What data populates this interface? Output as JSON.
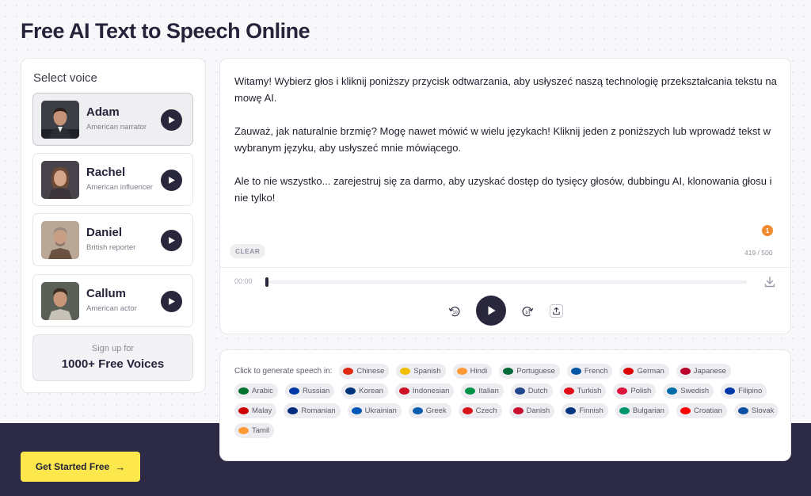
{
  "page": {
    "title": "Free AI Text to Speech Online"
  },
  "voice_panel": {
    "label": "Select voice",
    "voices": [
      {
        "name": "Adam",
        "description": "American narrator",
        "selected": true
      },
      {
        "name": "Rachel",
        "description": "American influencer",
        "selected": false
      },
      {
        "name": "Daniel",
        "description": "British reporter",
        "selected": false
      },
      {
        "name": "Callum",
        "description": "American actor",
        "selected": false
      }
    ],
    "signup": {
      "small": "Sign up for",
      "big": "1000+ Free Voices"
    }
  },
  "editor": {
    "paragraphs": [
      "Witamy! Wybierz głos i kliknij poniższy przycisk odtwarzania, aby usłyszeć naszą technologię przekształcania tekstu na mowę AI.",
      "Zauważ, jak naturalnie brzmię? Mogę nawet mówić w wielu językach! Kliknij jeden z poniższych lub wprowadź tekst w wybranym języku, aby usłyszeć mnie mówiącego.",
      "Ale to nie wszystko... zarejestruj się za darmo, aby uzyskać dostęp do tysięcy głosów, dubbingu AI, klonowania głosu i nie tylko!"
    ],
    "badge_count": "1",
    "clear_label": "CLEAR",
    "char_count": "419 / 500"
  },
  "player": {
    "time": "00:00",
    "progress": 0,
    "icons": [
      "download-icon",
      "rewind-10-icon",
      "play-icon",
      "forward-10-icon",
      "share-icon"
    ]
  },
  "languages": {
    "prompt": "Click to generate speech in:",
    "items": [
      {
        "name": "Chinese",
        "color": "#de2910"
      },
      {
        "name": "Spanish",
        "color": "#f1bf00"
      },
      {
        "name": "Hindi",
        "color": "#ff9933"
      },
      {
        "name": "Portuguese",
        "color": "#046a38"
      },
      {
        "name": "French",
        "color": "#0055a4"
      },
      {
        "name": "German",
        "color": "#dd0000"
      },
      {
        "name": "Japanese",
        "color": "#bc002d"
      },
      {
        "name": "Arabic",
        "color": "#00732f"
      },
      {
        "name": "Russian",
        "color": "#0039a6"
      },
      {
        "name": "Korean",
        "color": "#003478"
      },
      {
        "name": "Indonesian",
        "color": "#ce1126"
      },
      {
        "name": "Italian",
        "color": "#009246"
      },
      {
        "name": "Dutch",
        "color": "#21468b"
      },
      {
        "name": "Turkish",
        "color": "#e30a17"
      },
      {
        "name": "Polish",
        "color": "#dc143c"
      },
      {
        "name": "Swedish",
        "color": "#006aa7"
      },
      {
        "name": "Filipino",
        "color": "#0038a8"
      },
      {
        "name": "Malay",
        "color": "#cc0001"
      },
      {
        "name": "Romanian",
        "color": "#002b7f"
      },
      {
        "name": "Ukrainian",
        "color": "#0057b7"
      },
      {
        "name": "Greek",
        "color": "#0d5eaf"
      },
      {
        "name": "Czech",
        "color": "#d7141a"
      },
      {
        "name": "Danish",
        "color": "#c8102e"
      },
      {
        "name": "Finnish",
        "color": "#003580"
      },
      {
        "name": "Bulgarian",
        "color": "#00966e"
      },
      {
        "name": "Croatian",
        "color": "#ff0000"
      },
      {
        "name": "Slovak",
        "color": "#0b4ea2"
      },
      {
        "name": "Tamil",
        "color": "#ff9933"
      }
    ]
  },
  "cta": {
    "label": "Get Started Free",
    "arrow": "→"
  },
  "colors": {
    "accent_dark": "#29273b",
    "cta_yellow": "#fce74c",
    "footer_bg": "#2c2a44",
    "badge_orange": "#f08a2f"
  }
}
